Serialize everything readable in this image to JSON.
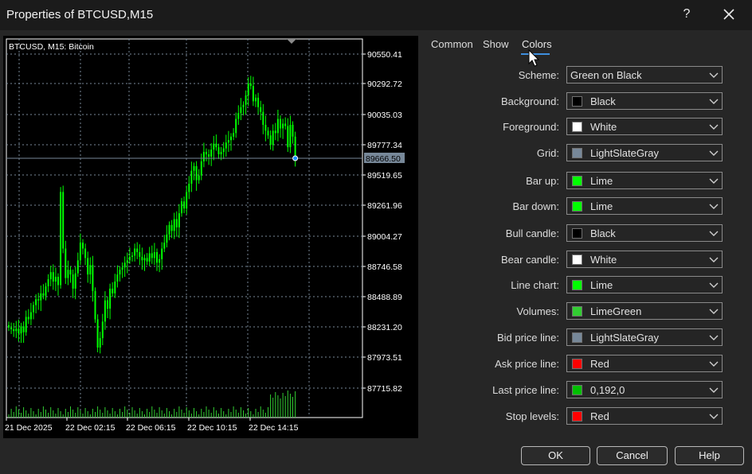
{
  "window": {
    "title": "Properties of BTCUSD,M15",
    "help_glyph": "?",
    "close_icon": "close-icon"
  },
  "tabs": [
    {
      "label": "Common",
      "active": false
    },
    {
      "label": "Show",
      "active": false
    },
    {
      "label": "Colors",
      "active": true
    }
  ],
  "preview": {
    "symbol_label": "BTCUSD, M15:  Bitcoin",
    "current_price": "89666.50",
    "price_labels": [
      "90550.41",
      "90292.72",
      "90035.03",
      "89777.34",
      "89519.65",
      "89261.96",
      "89004.27",
      "88746.58",
      "88488.89",
      "88231.20",
      "87973.51",
      "87715.82"
    ],
    "time_labels": [
      "21 Dec 2025",
      "22 Dec 02:15",
      "22 Dec 06:15",
      "22 Dec 10:15",
      "22 Dec 14:15"
    ],
    "colors": {
      "background": "#000000",
      "candles": "#00ff00",
      "grid": "#778899",
      "volumes": "#32cd32",
      "text": "#ffffff"
    }
  },
  "settings": [
    {
      "label": "Scheme:",
      "value": "Green on Black",
      "color": null
    },
    {
      "label": "Background:",
      "value": "Black",
      "color": "#000000"
    },
    {
      "label": "Foreground:",
      "value": "White",
      "color": "#ffffff"
    },
    {
      "label": "Grid:",
      "value": "LightSlateGray",
      "color": "#778899"
    },
    {
      "label": "Bar up:",
      "value": "Lime",
      "color": "#00ff00"
    },
    {
      "label": "Bar down:",
      "value": "Lime",
      "color": "#00ff00"
    },
    {
      "label": "Bull candle:",
      "value": "Black",
      "color": "#000000"
    },
    {
      "label": "Bear candle:",
      "value": "White",
      "color": "#ffffff"
    },
    {
      "label": "Line chart:",
      "value": "Lime",
      "color": "#00ff00"
    },
    {
      "label": "Volumes:",
      "value": "LimeGreen",
      "color": "#32cd32"
    },
    {
      "label": "Bid price line:",
      "value": "LightSlateGray",
      "color": "#778899"
    },
    {
      "label": "Ask price line:",
      "value": "Red",
      "color": "#ff0000"
    },
    {
      "label": "Last price line:",
      "value": "0,192,0",
      "color": "#00c000"
    },
    {
      "label": "Stop levels:",
      "value": "Red",
      "color": "#ff0000"
    }
  ],
  "buttons": {
    "ok": "OK",
    "cancel": "Cancel",
    "help": "Help"
  }
}
